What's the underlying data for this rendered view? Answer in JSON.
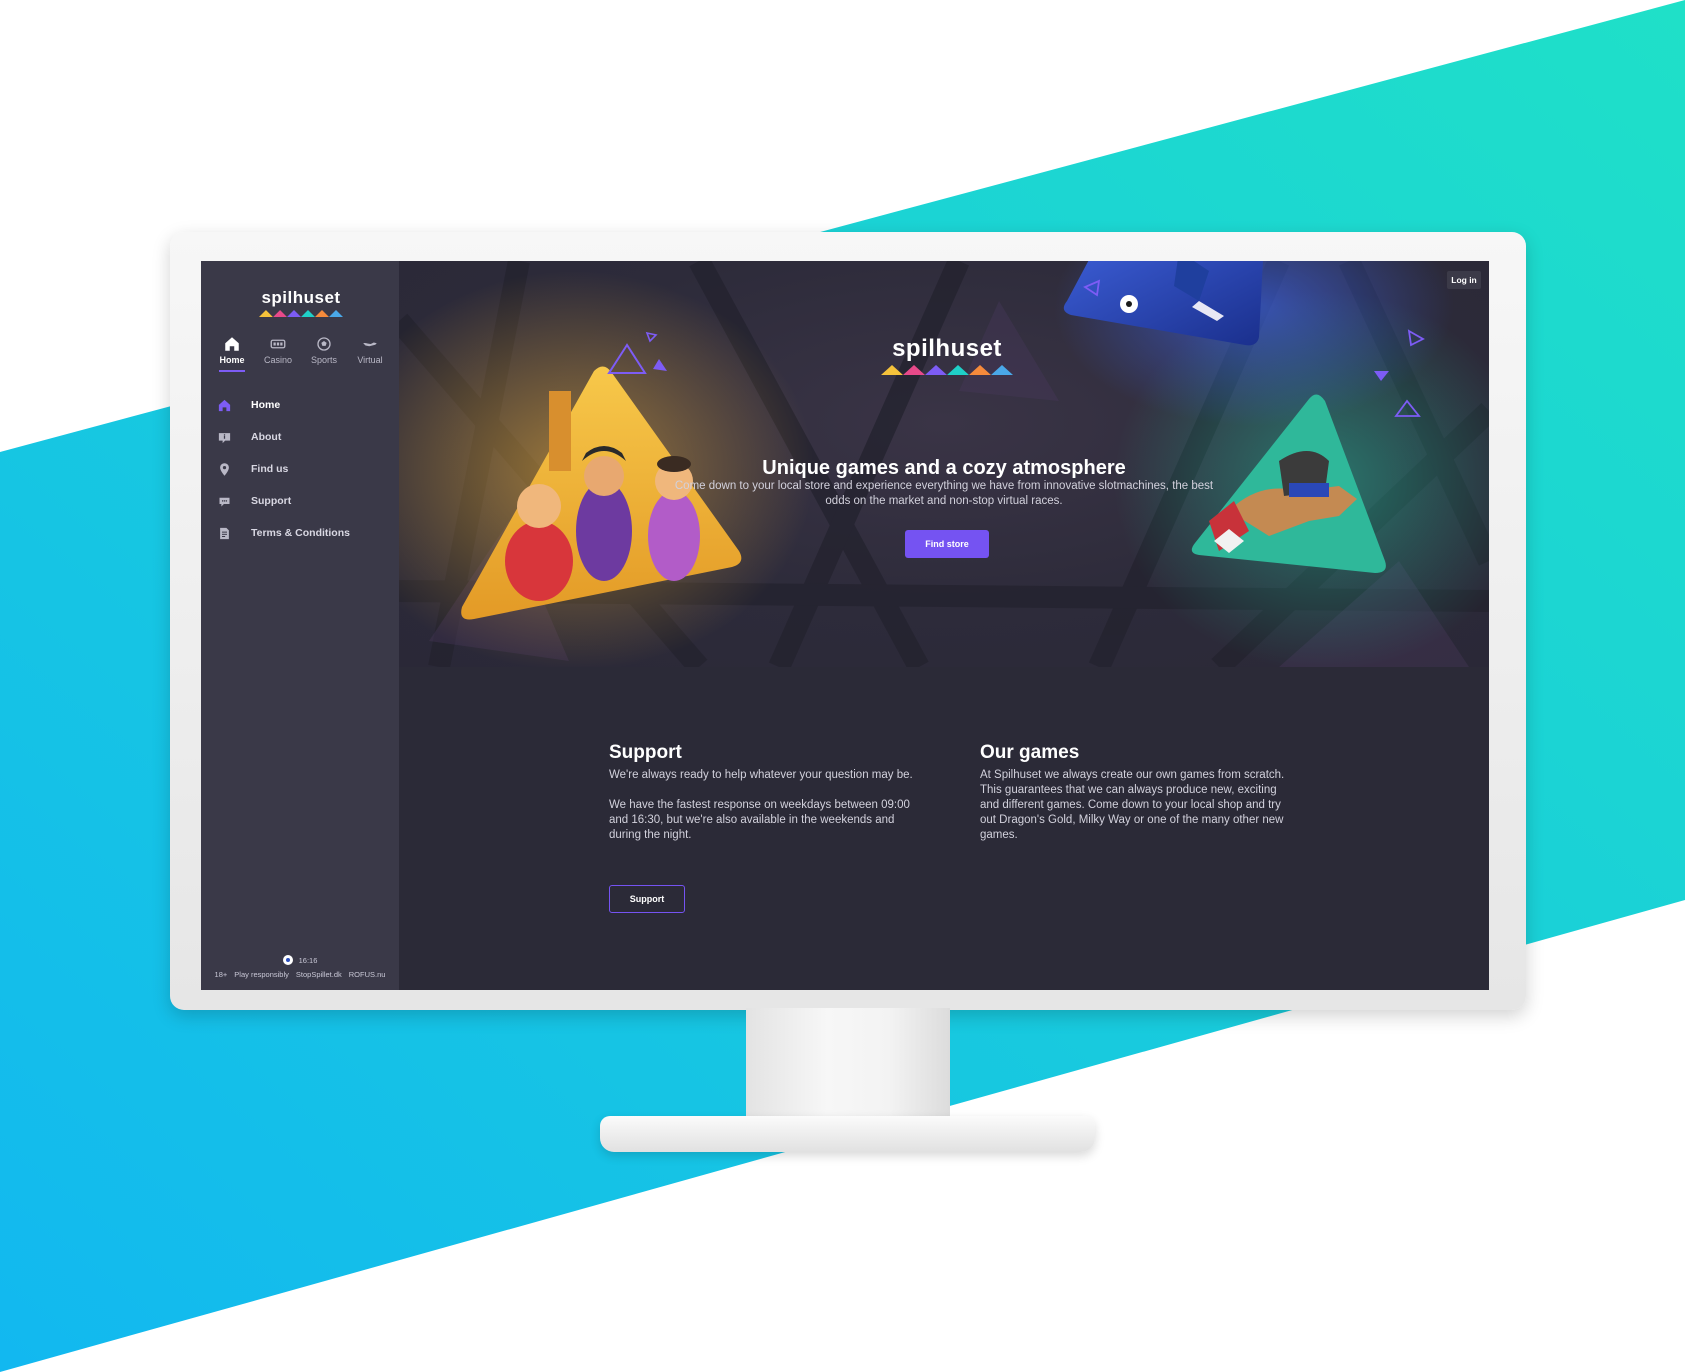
{
  "brand": {
    "name": "spilhuset",
    "stripe_colors": [
      "#f5c23b",
      "#e84a8a",
      "#7d5cf5",
      "#1fd0c8",
      "#f58a3b",
      "#4aa8e8"
    ]
  },
  "colors": {
    "accent": "#7553f2",
    "sidebar_bg": "#3a3948",
    "page_bg": "#2b2a37",
    "backdrop_cyan": "#16c8e8"
  },
  "topnav": {
    "items": [
      {
        "label": "Home",
        "icon": "home-icon",
        "active": true
      },
      {
        "label": "Casino",
        "icon": "slot-machine-icon",
        "active": false
      },
      {
        "label": "Sports",
        "icon": "football-icon",
        "active": false
      },
      {
        "label": "Virtual",
        "icon": "racing-dog-icon",
        "active": false
      }
    ]
  },
  "sidebar": {
    "items": [
      {
        "label": "Home",
        "icon": "home-icon",
        "active": true
      },
      {
        "label": "About",
        "icon": "info-card-icon",
        "active": false
      },
      {
        "label": "Find us",
        "icon": "location-pin-icon",
        "active": false
      },
      {
        "label": "Support",
        "icon": "chat-bubble-icon",
        "active": false
      },
      {
        "label": "Terms & Conditions",
        "icon": "document-icon",
        "active": false
      }
    ],
    "footer": {
      "time": "16:16",
      "flag_icon": "flag-icon",
      "links": [
        "18+",
        "Play responsibly",
        "StopSpillet.dk",
        "ROFUS.nu"
      ]
    }
  },
  "header": {
    "login_label": "Log in"
  },
  "hero": {
    "title": "Unique games and a cozy atmosphere",
    "subtitle": "Come down to your local store and experience everything we have from innovative slotmachines, the best odds on the market and non-stop virtual races.",
    "button_label": "Find store"
  },
  "support": {
    "title": "Support",
    "paragraph1": "We're always ready to help whatever your question may be.",
    "paragraph2": "We have the fastest response on weekdays between 09:00 and 16:30, but we're also available in the weekends and during the night.",
    "button_label": "Support"
  },
  "games": {
    "title": "Our games",
    "paragraph": "At Spilhuset we always create our own games from scratch. This guarantees that we can always produce new, exciting and different games. Come down to your local shop and try out Dragon's Gold, Milky Way or one of the many other new games."
  }
}
